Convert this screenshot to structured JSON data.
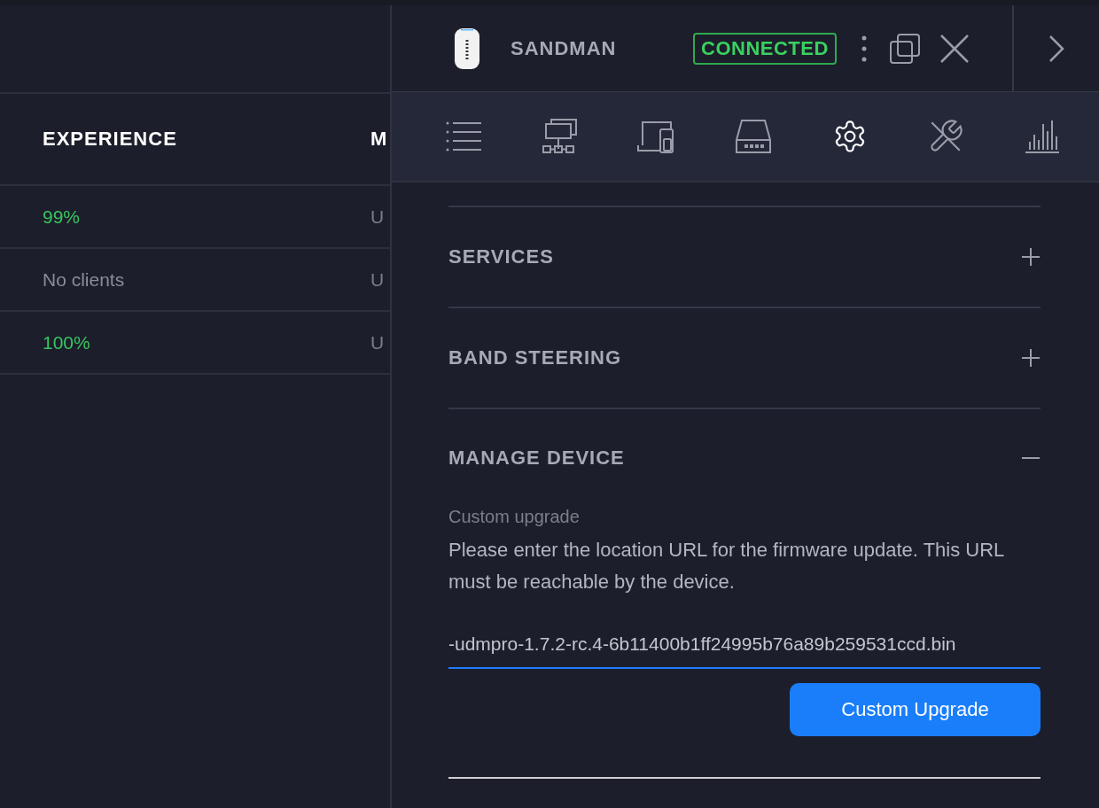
{
  "table": {
    "columns": [
      {
        "label": "EXPERIENCE"
      },
      {
        "label": "M"
      }
    ],
    "rows": [
      {
        "experience": "99%",
        "color": "#39c460",
        "column_2": "U"
      },
      {
        "experience": "No clients",
        "color": "#8a8d98",
        "column_2": "U"
      },
      {
        "experience": "100%",
        "color": "#39c460",
        "column_2": "U"
      }
    ]
  },
  "panel": {
    "device_name": "SANDMAN",
    "status": "CONNECTED",
    "tabs": [
      {
        "kind": "list",
        "selected": false
      },
      {
        "kind": "topology",
        "selected": false
      },
      {
        "kind": "devices",
        "selected": false
      },
      {
        "kind": "storage",
        "selected": false
      },
      {
        "kind": "settings",
        "selected": true
      },
      {
        "kind": "tools",
        "selected": false
      },
      {
        "kind": "stats",
        "selected": false
      }
    ],
    "sections": [
      {
        "title": "SERVICES",
        "expanded": false
      },
      {
        "title": "BAND STEERING",
        "expanded": false
      },
      {
        "title": "MANAGE DEVICE",
        "expanded": true,
        "label": "Custom upgrade",
        "description": "Please enter the location URL for the firmware update. This URL must be reachable by the device.",
        "url_value": "-udmpro-1.7.2-rc.4-6b11400b1ff24995b76a89b259531ccd.bin",
        "button": "Custom Upgrade"
      }
    ]
  }
}
